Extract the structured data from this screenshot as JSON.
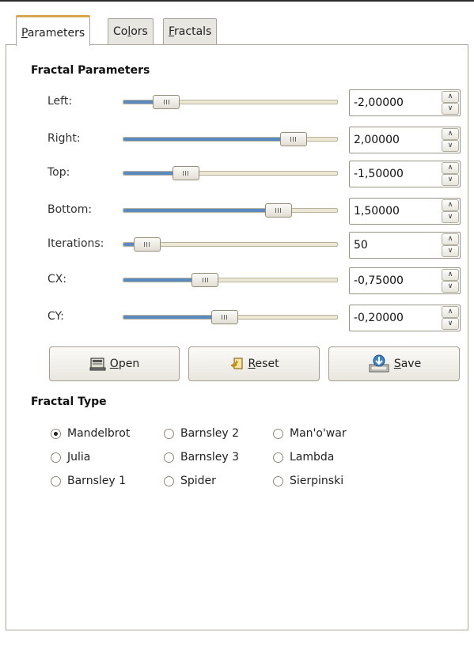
{
  "tabs": [
    {
      "pre": "",
      "key": "P",
      "post": "arameters"
    },
    {
      "pre": "Co",
      "key": "l",
      "post": "ors"
    },
    {
      "pre": "",
      "key": "F",
      "post": "ractals"
    }
  ],
  "fractal_parameters": {
    "title": "Fractal Parameters",
    "rows": [
      {
        "label": "Left:",
        "value": "-2,00000",
        "position": 0.2
      },
      {
        "label": "Right:",
        "value": "2,00000",
        "position": 0.79
      },
      {
        "label": "Top:",
        "value": "-1,50000",
        "position": 0.29
      },
      {
        "label": "Bottom:",
        "value": "1,50000",
        "position": 0.72
      },
      {
        "label": "Iterations:",
        "value": "50",
        "position": 0.11
      },
      {
        "label": "CX:",
        "value": "-0,75000",
        "position": 0.38
      },
      {
        "label": "CY:",
        "value": "-0,20000",
        "position": 0.47
      }
    ]
  },
  "buttons": {
    "open": {
      "key": "O",
      "rest": "pen"
    },
    "reset": {
      "key": "R",
      "rest": "eset"
    },
    "save": {
      "key": "S",
      "rest": "ave"
    }
  },
  "fractal_type": {
    "title": "Fractal Type",
    "options": [
      {
        "label": "Mandelbrot",
        "checked": true
      },
      {
        "label": "Barnsley 2",
        "checked": false
      },
      {
        "label": "Man'o'war",
        "checked": false
      },
      {
        "label": "Julia",
        "checked": false
      },
      {
        "label": "Barnsley 3",
        "checked": false
      },
      {
        "label": "Lambda",
        "checked": false
      },
      {
        "label": "Barnsley 1",
        "checked": false
      },
      {
        "label": "Spider",
        "checked": false
      },
      {
        "label": "Sierpinski",
        "checked": false
      }
    ]
  },
  "colors": {
    "slider_fill": "#5a8ac0",
    "active_tab_accent": "#d7a64a"
  }
}
